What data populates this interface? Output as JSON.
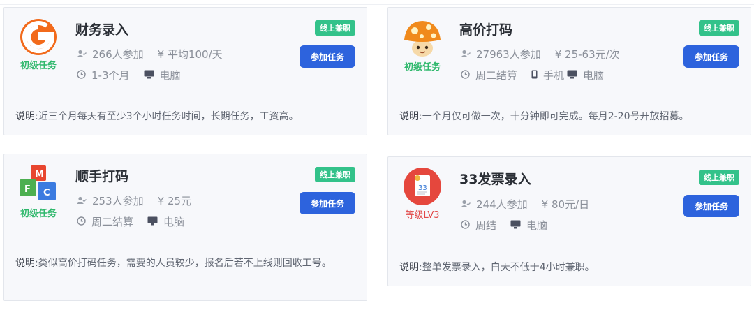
{
  "colors": {
    "badge": "#33c28a",
    "button": "#2d63dd",
    "level_green": "#2fb86c",
    "level_red": "#e24a4a"
  },
  "cards": [
    {
      "icon": "g-logo-icon",
      "level": "初级任务",
      "title": "财务录入",
      "participants": "266人参加",
      "price": "¥  平均100/天",
      "duration": "1-3个月",
      "devices": [
        "电脑"
      ],
      "badge": "线上兼职",
      "button": "参加任务",
      "desc_label": "说明",
      "desc_text": ":近三个月每天有至少3个小时任务时间，长期任务，工资高。"
    },
    {
      "icon": "mushroom-icon",
      "level": "初级任务",
      "title": "高价打码",
      "participants": "27963人参加",
      "price": "¥  25-63元/次",
      "duration": "周二结算",
      "devices": [
        "手机",
        "电脑"
      ],
      "badge": "线上兼职",
      "button": "参加任务",
      "desc_label": "说明",
      "desc_text": ":一个月仅可做一次，十分钟即可完成。每月2-20号开放招募。"
    },
    {
      "icon": "mfc-cubes-icon",
      "level": "初级任务",
      "title": "顺手打码",
      "participants": "253人参加",
      "price": "¥  25元",
      "duration": "周二结算",
      "devices": [
        "电脑"
      ],
      "badge": "线上兼职",
      "button": "参加任务",
      "desc_label": "说明",
      "desc_text": ":类似高价打码任务，需要的人员较少，报名后若不上线则回收工号。"
    },
    {
      "icon": "invoice-icon",
      "level": "等级LV3",
      "title": "33发票录入",
      "participants": "244人参加",
      "price": "¥  80元/日",
      "duration": "周结",
      "devices": [
        "电脑"
      ],
      "badge": "线上兼职",
      "button": "参加任务",
      "desc_label": "说明",
      "desc_text": ":整单发票录入，白天不低于4小时兼职。"
    }
  ]
}
